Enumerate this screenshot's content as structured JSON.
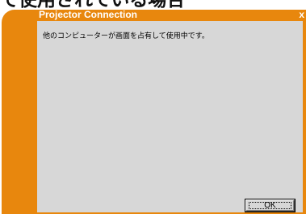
{
  "page": {
    "heading": "で使用されている場合"
  },
  "dialog": {
    "title": "Projector Connection",
    "close_label": "x",
    "message": "他のコンピューターが画面を占有して使用中です。",
    "ok_label": "OK"
  },
  "colors": {
    "frame": "#e8870d",
    "client": "#d7d7d7",
    "title_text": "#ffffff"
  }
}
